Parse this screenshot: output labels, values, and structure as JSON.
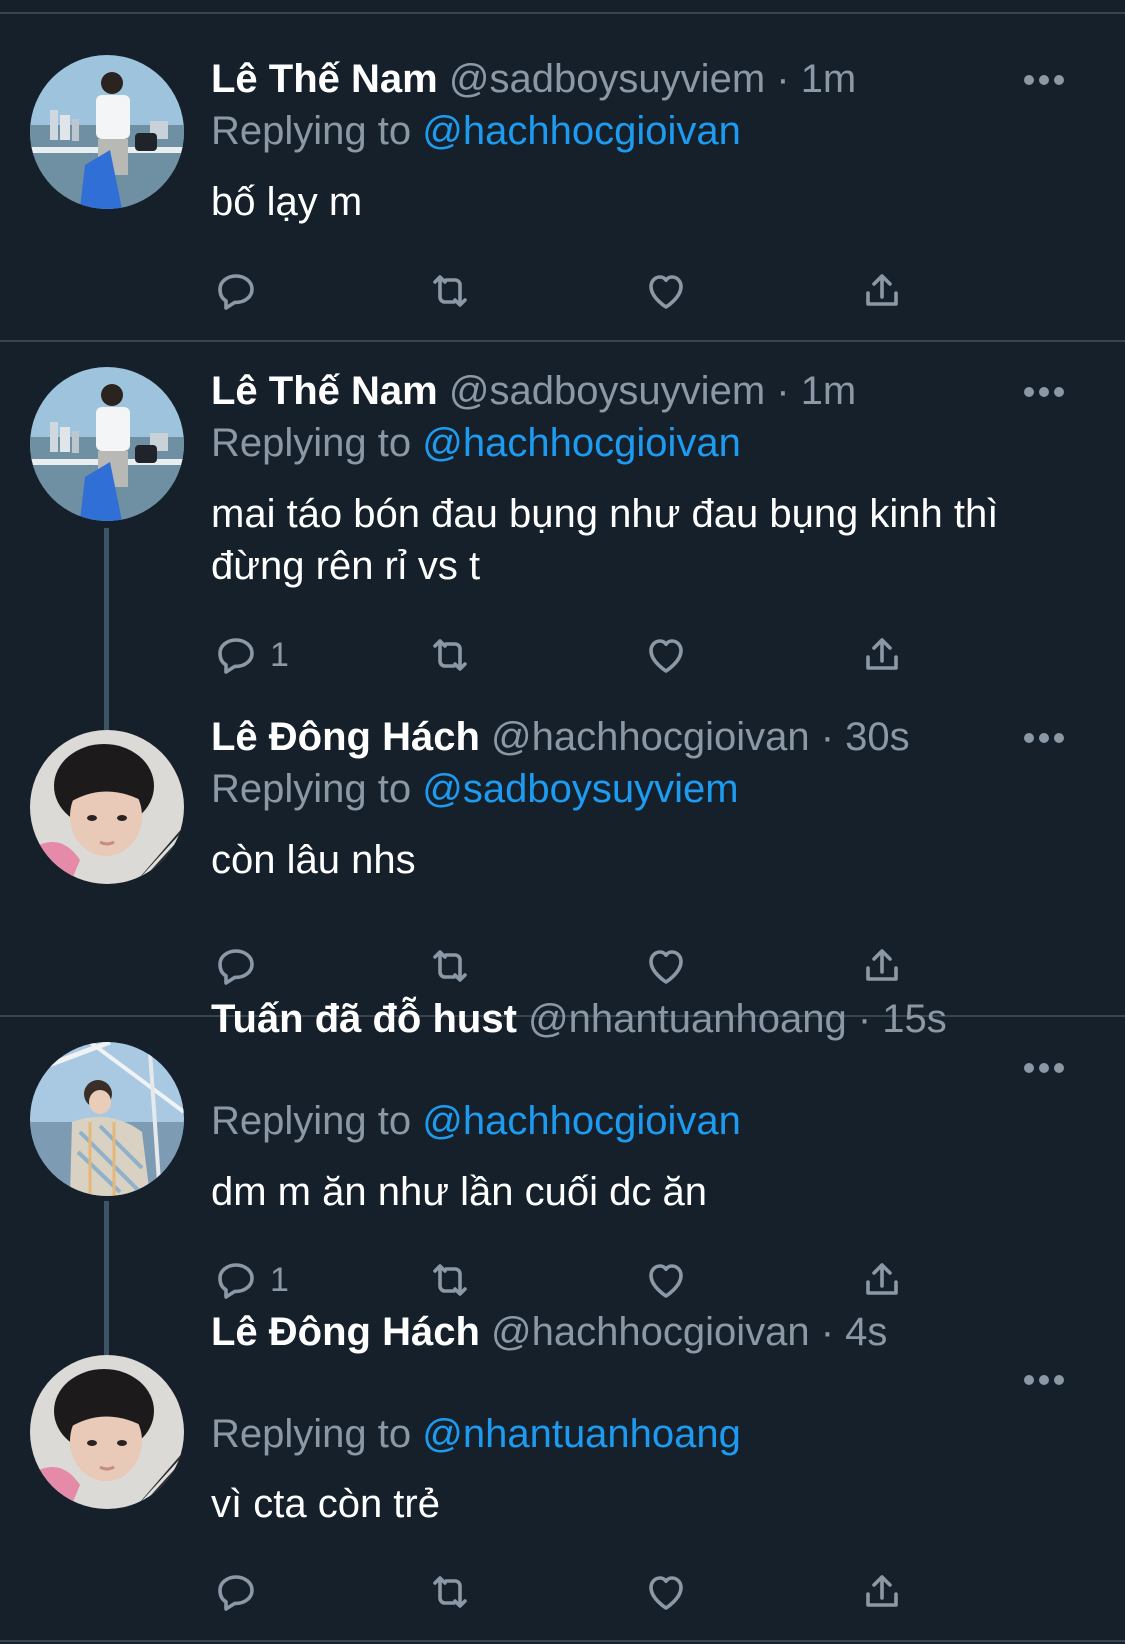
{
  "tweets": [
    {
      "name": "Lê Thế Nam",
      "handle": "@sadboysuyviem",
      "time": "1m",
      "replying_prefix": "Replying to ",
      "replying_to": "@hachhocgioivan",
      "text": "bố lạy m",
      "reply_count": "",
      "avatar": "boat-photo-avatar"
    },
    {
      "name": "Lê Thế Nam",
      "handle": "@sadboysuyviem",
      "time": "1m",
      "replying_prefix": "Replying to ",
      "replying_to": "@hachhocgioivan",
      "text": "mai táo bón đau bụng như đau bụng kinh thì đừng rên rỉ vs t",
      "reply_count": "1",
      "avatar": "boat-photo-avatar"
    },
    {
      "name": "Lê Đông Hách",
      "handle": "@hachhocgioivan",
      "time": "30s",
      "replying_prefix": "Replying to ",
      "replying_to": "@sadboysuyviem",
      "text": "còn lâu nhs",
      "reply_count": "",
      "avatar": "portrait-avatar"
    },
    {
      "name": "Tuấn đã đỗ hust",
      "handle": "@nhantuanhoang",
      "time": "15s",
      "replying_prefix": "Replying to ",
      "replying_to": "@hachhocgioivan",
      "text": "dm m ăn như lần cuối dc ăn",
      "reply_count": "1",
      "avatar": "sea-photo-avatar"
    },
    {
      "name": "Lê Đông Hách",
      "handle": "@hachhocgioivan",
      "time": "4s",
      "replying_prefix": "Replying to ",
      "replying_to": "@nhantuanhoang",
      "text": "vì cta còn trẻ",
      "reply_count": "",
      "avatar": "portrait-avatar"
    }
  ],
  "meta_separator": " · ",
  "icons": {
    "reply": "reply-icon",
    "retweet": "retweet-icon",
    "like": "heart-icon",
    "share": "share-icon",
    "more": "more-icon"
  },
  "colors": {
    "background": "#15202b",
    "divider": "#38444d",
    "secondary_text": "#8b98a5",
    "mention": "#1d9bf0"
  }
}
